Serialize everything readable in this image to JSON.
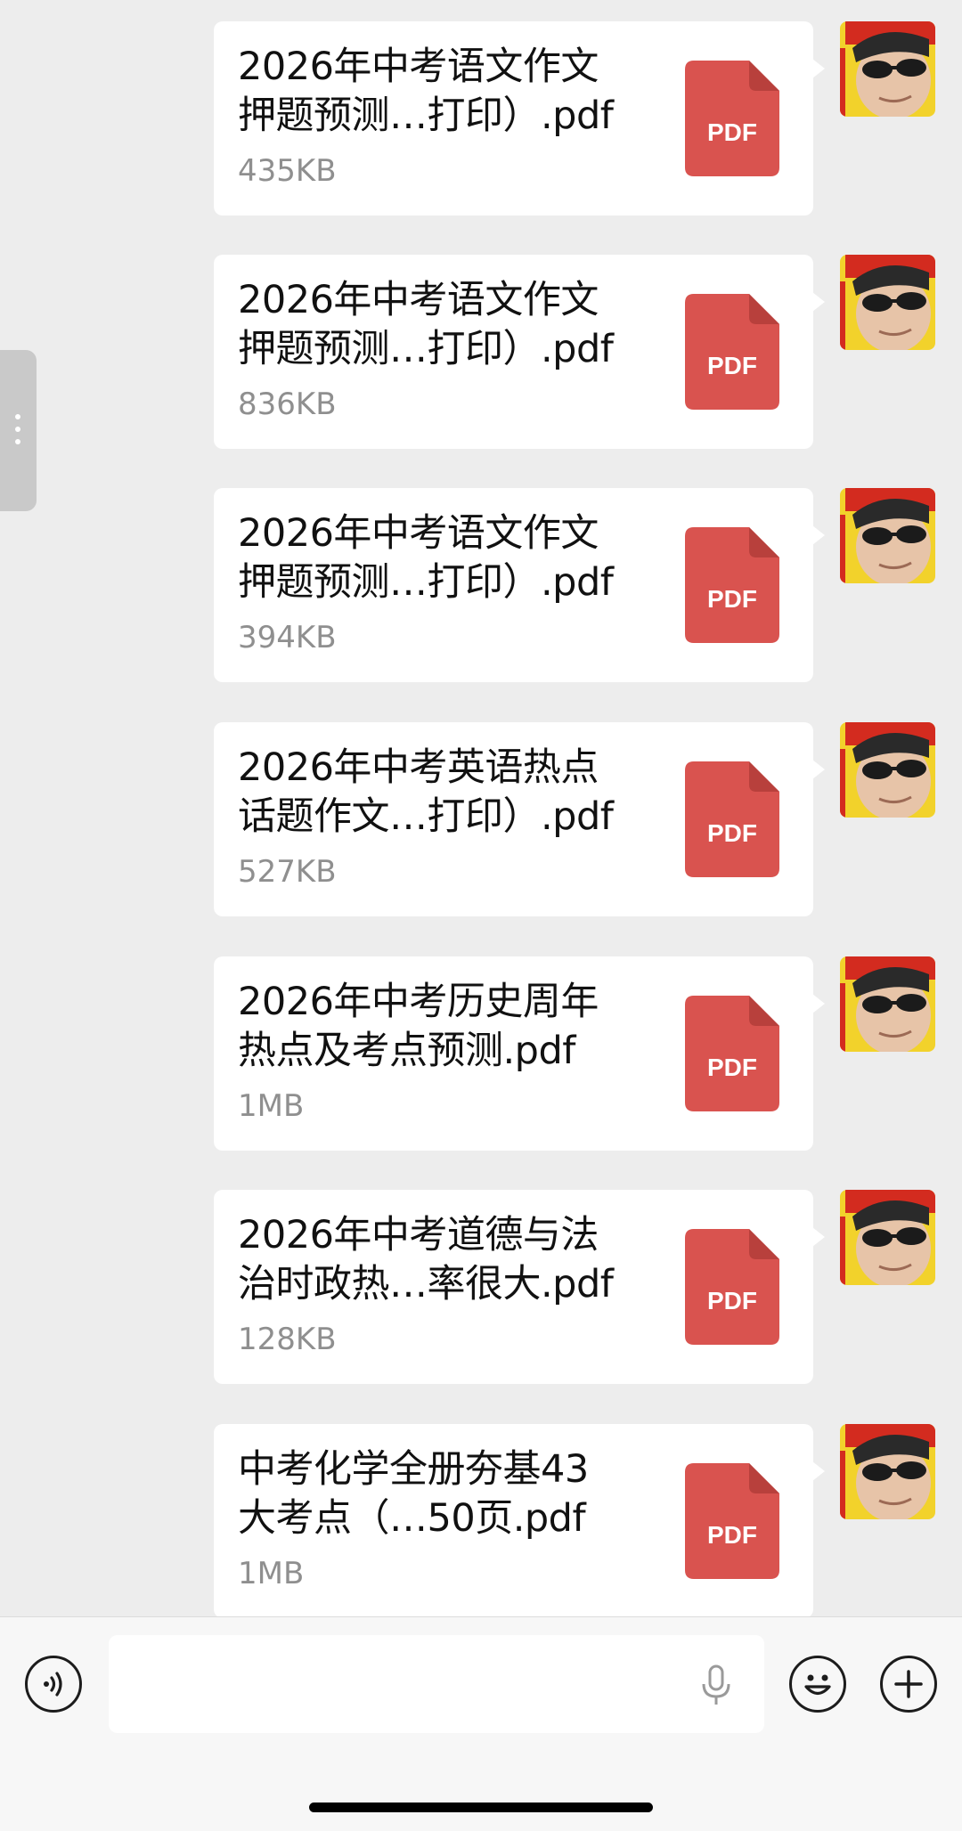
{
  "messages": [
    {
      "file_name": "2026年中考语文作文\n押题预测…打印）.pdf",
      "file_size": "435KB",
      "file_type": "PDF"
    },
    {
      "file_name": "2026年中考语文作文\n押题预测…打印）.pdf",
      "file_size": "836KB",
      "file_type": "PDF"
    },
    {
      "file_name": "2026年中考语文作文\n押题预测…打印）.pdf",
      "file_size": "394KB",
      "file_type": "PDF"
    },
    {
      "file_name": "2026年中考英语热点\n话题作文…打印）.pdf",
      "file_size": "527KB",
      "file_type": "PDF"
    },
    {
      "file_name": "2026年中考历史周年\n热点及考点预测.pdf",
      "file_size": "1MB",
      "file_type": "PDF"
    },
    {
      "file_name": "2026年中考道德与法\n治时政热…率很大.pdf",
      "file_size": "128KB",
      "file_type": "PDF"
    },
    {
      "file_name": "中考化学全册夯基43\n大考点（…50页.pdf",
      "file_size": "1MB",
      "file_type": "PDF"
    }
  ],
  "input_bar": {
    "voice_toggle_icon": "voice-wave-icon",
    "mic_icon": "microphone-icon",
    "emoji_icon": "smile-face-icon",
    "add_icon": "plus-circle-icon",
    "text_value": ""
  },
  "colors": {
    "background": "#ededed",
    "bubble": "#ffffff",
    "pdf_red": "#d9534f",
    "file_size_gray": "#8f8f8f"
  }
}
